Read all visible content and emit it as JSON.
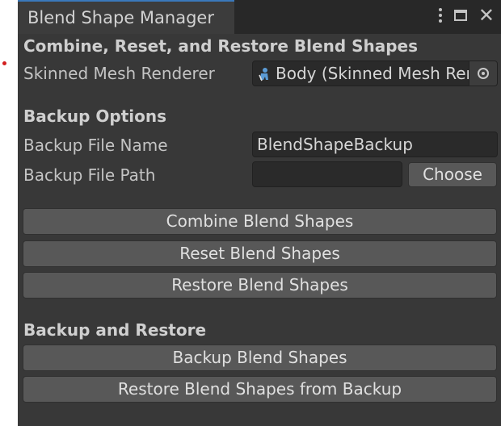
{
  "window": {
    "tab_title": "Blend Shape Manager",
    "accent": "#3a79bb",
    "icons": [
      "kebab-menu-icon",
      "maximize-icon",
      "close-icon"
    ],
    "close_glyph": "✕"
  },
  "combine_section": {
    "heading": "Combine, Reset, and Restore Blend Shapes",
    "skinned_label": "Skinned Mesh Renderer",
    "skinned_value": "Body (Skinned Mesh Renderer)"
  },
  "backup_options": {
    "heading": "Backup Options",
    "file_name_label": "Backup File Name",
    "file_name_value": "BlendShapeBackup",
    "file_path_label": "Backup File Path",
    "file_path_value": "",
    "choose_label": "Choose"
  },
  "actions": {
    "combine": "Combine Blend Shapes",
    "reset": "Reset Blend Shapes",
    "restore": "Restore Blend Shapes"
  },
  "backup_restore": {
    "heading": "Backup and Restore",
    "backup": "Backup Blend Shapes",
    "restore_from_backup": "Restore Blend Shapes from Backup"
  }
}
